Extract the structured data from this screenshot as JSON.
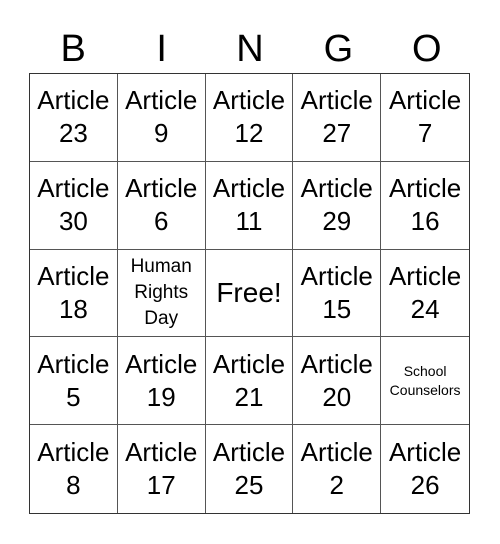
{
  "header": [
    "B",
    "I",
    "N",
    "G",
    "O"
  ],
  "cells": [
    "Article 23",
    "Article 9",
    "Article 12",
    "Article 27",
    "Article 7",
    "Article 30",
    "Article 6",
    "Article 11",
    "Article 29",
    "Article 16",
    "Article 18",
    "Human Rights Day",
    "Free!",
    "Article 15",
    "Article 24",
    "Article 5",
    "Article 19",
    "Article 21",
    "Article 20",
    "School Counselors",
    "Article 8",
    "Article 17",
    "Article 25",
    "Article 2",
    "Article 26"
  ]
}
